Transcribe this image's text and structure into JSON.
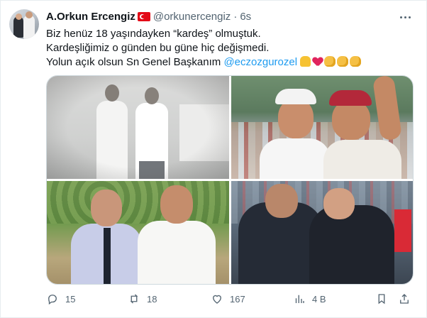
{
  "author": {
    "display_name": "A.Orkun Ercengiz",
    "handle": "@orkunercengiz",
    "separator": "·",
    "time": "6s"
  },
  "tweet": {
    "line1": "Biz henüz 18 yaşındayken “kardeş” olmuştuk.",
    "line2": "Kardeşliğimiz o günden bu güne hiç değişmedi.",
    "line3_text": "Yolun açık olsun Sn Genel Başkanım ",
    "mention": "@eczozgurozel"
  },
  "icons": {
    "more": "more-horizontal-icon",
    "reply": "reply-icon",
    "retweet": "retweet-icon",
    "like": "heart-icon",
    "views": "views-icon",
    "bookmark": "bookmark-icon",
    "share": "share-icon"
  },
  "metrics": {
    "replies": "15",
    "retweets": "18",
    "likes": "167",
    "views": "4 B"
  },
  "colors": {
    "accent": "#1d9bf0",
    "text": "#0f1419",
    "muted": "#536471"
  }
}
